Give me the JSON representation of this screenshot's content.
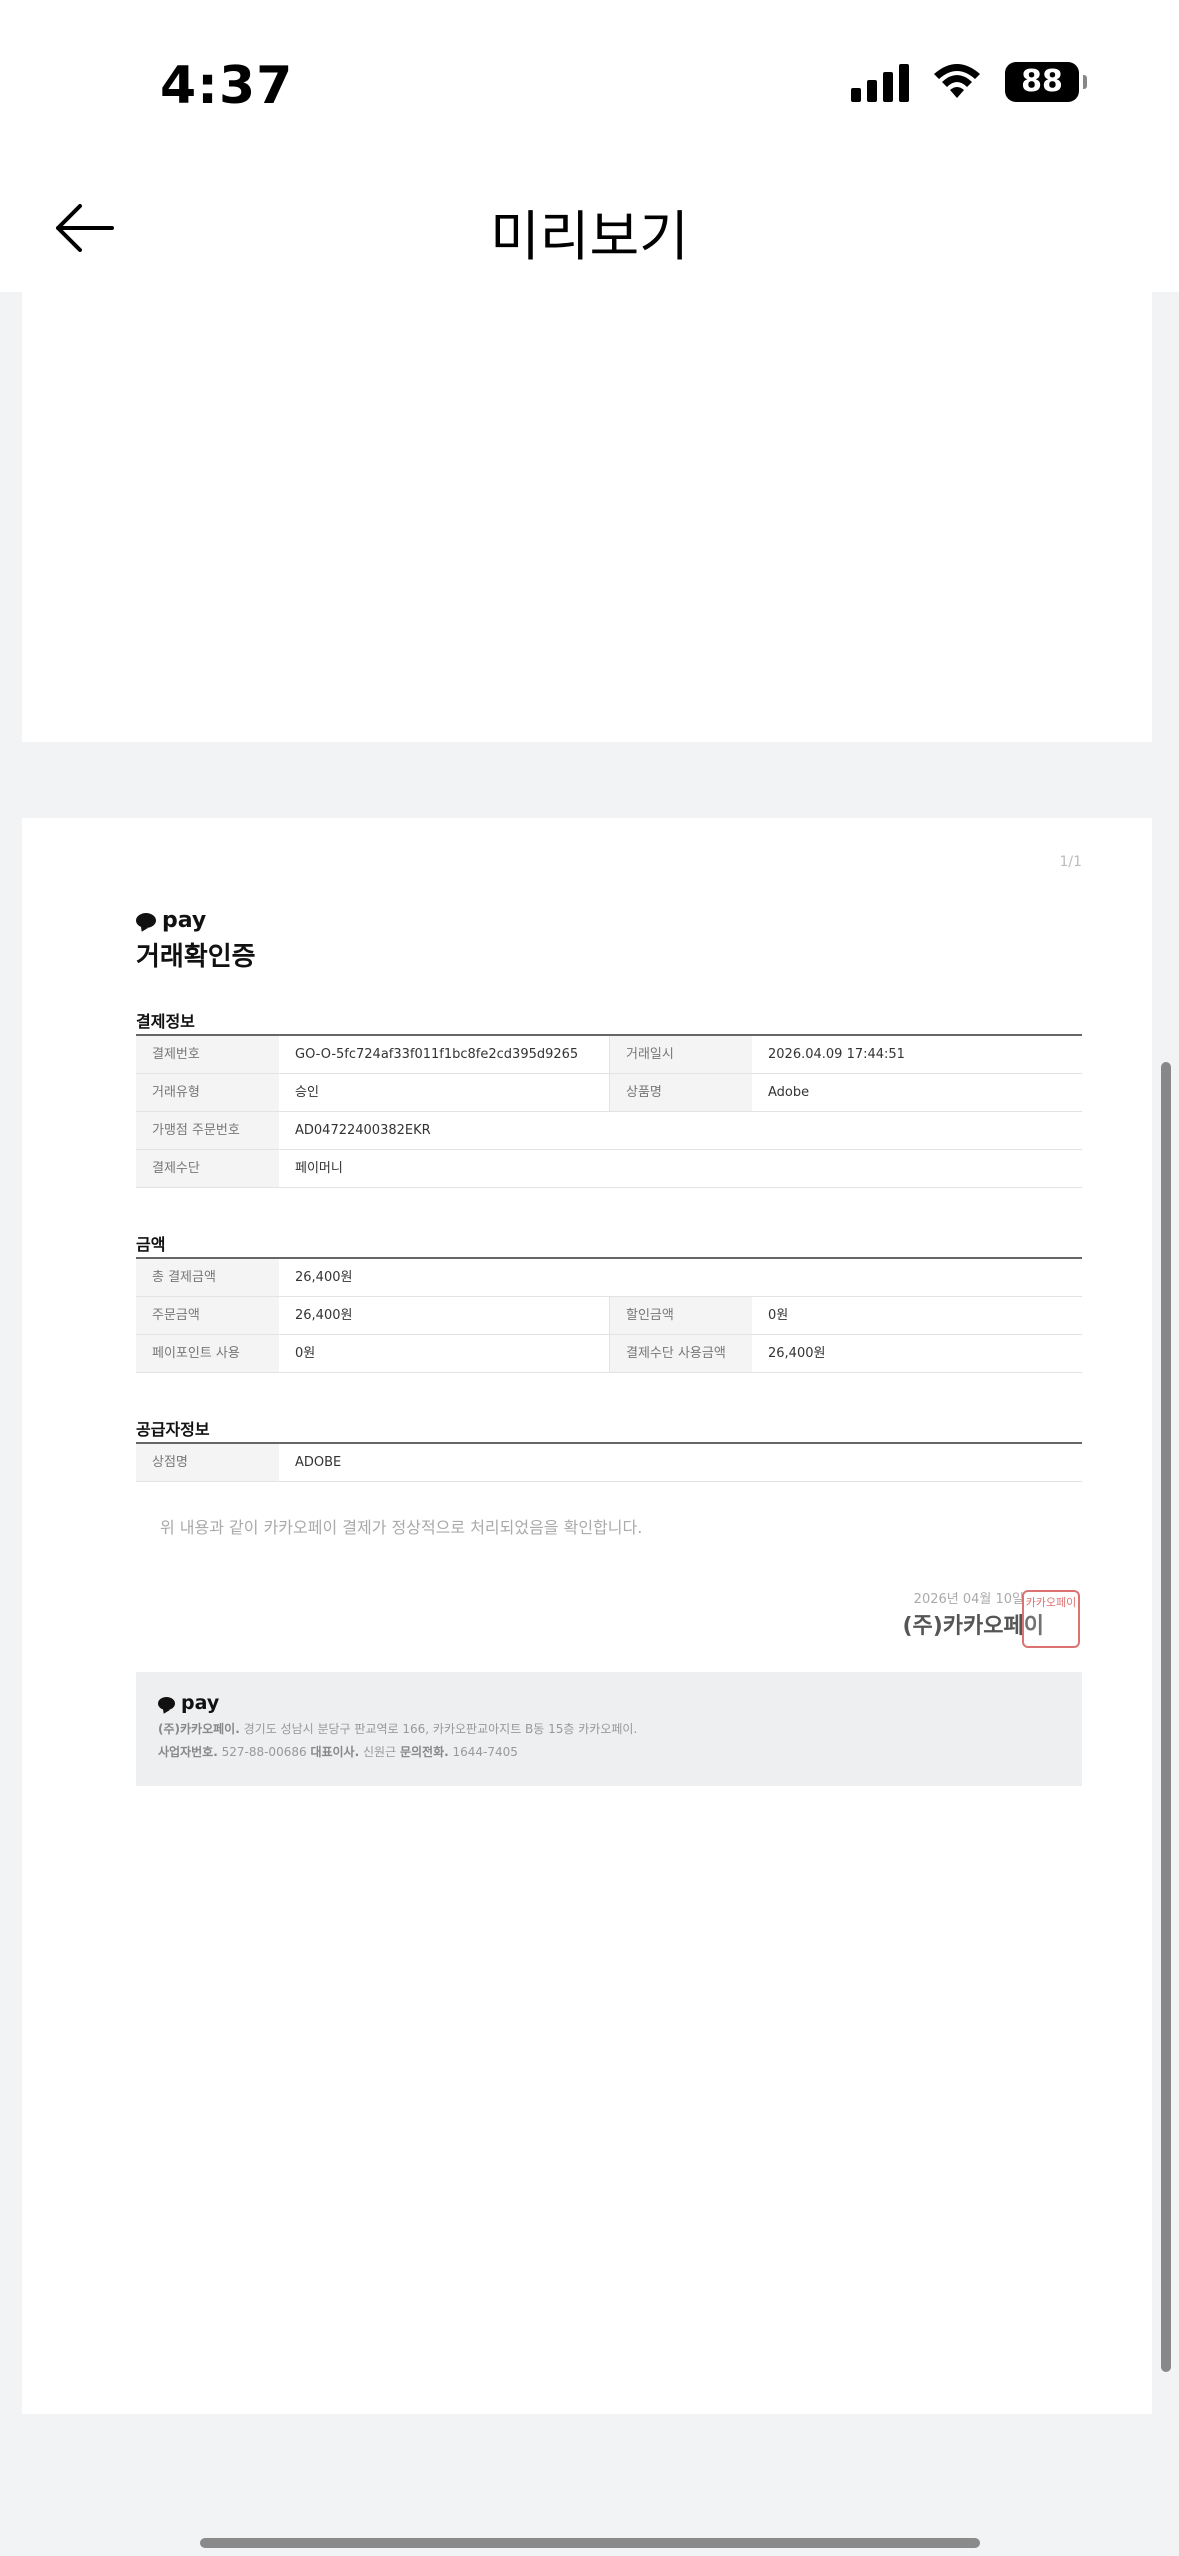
{
  "status": {
    "time": "4:37",
    "battery": "88"
  },
  "header": {
    "title": "미리보기"
  },
  "doc": {
    "page_indicator": "1/1",
    "brand": "pay",
    "title": "거래확인증",
    "payment": {
      "title": "결제정보",
      "rows": [
        {
          "l1": "결제번호",
          "v1": "GO-O-5fc724af33f011f1bc8fe2cd395d9265",
          "l2": "거래일시",
          "v2": "2026.04.09 17:44:51"
        },
        {
          "l1": "거래유형",
          "v1": "승인",
          "l2": "상품명",
          "v2": "Adobe"
        },
        {
          "l1": "가맹점 주문번호",
          "v1": "AD04722400382EKR"
        },
        {
          "l1": "결제수단",
          "v1": "페이머니"
        }
      ]
    },
    "amount": {
      "title": "금액",
      "rows": [
        {
          "l1": "총 결제금액",
          "v1": "26,400원"
        },
        {
          "l1": "주문금액",
          "v1": "26,400원",
          "l2": "할인금액",
          "v2": "0원"
        },
        {
          "l1": "페이포인트 사용",
          "v1": "0원",
          "l2": "결제수단 사용금액",
          "v2": "26,400원"
        }
      ]
    },
    "supplier": {
      "title": "공급자정보",
      "rows": [
        {
          "l1": "상점명",
          "v1": "ADOBE"
        }
      ]
    },
    "confirm_text": "위 내용과 같이 카카오페이 결제가 정상적으로 처리되었음을 확인합니다.",
    "issue_date": "2026년 04월 10일",
    "company": "(주)카카오페이",
    "seal_text": "카카오페이",
    "footer": {
      "brand": "pay",
      "line1_bold": "(주)카카오페이.",
      "line1": "경기도 성남시 분당구 판교역로 166, 카카오판교아지트 B동 15층 카카오페이.",
      "l2_b1": "사업자번호.",
      "l2_v1": "527-88-00686",
      "l2_b2": "대표이사.",
      "l2_v2": "신원근",
      "l2_b3": "문의전화.",
      "l2_v3": "1644-7405"
    }
  }
}
